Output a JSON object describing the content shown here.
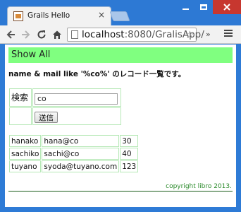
{
  "browser": {
    "tab_title": "Grails Hello",
    "tab_close": "×",
    "url_host": "localhost",
    "url_rest": ":8080/GralisApp/",
    "icons": {
      "back": "arrow-left-icon",
      "forward": "arrow-right-icon",
      "reload": "reload-icon",
      "home": "home-icon",
      "star": "star-icon",
      "extensions": "chevron-double-right-icon",
      "menu": "hamburger-menu-icon"
    }
  },
  "page": {
    "header_label": "Show All",
    "description": "name & mail like '%co%' のレコード一覧です。",
    "search_label": "検索",
    "search_value": "co",
    "submit_label": "送信",
    "results": [
      {
        "name": "hanako",
        "mail": "hana@co",
        "age": "30"
      },
      {
        "name": "sachiko",
        "mail": "sachi@co",
        "age": "40"
      },
      {
        "name": "tuyano",
        "mail": "syoda@tuyano.com",
        "age": "123"
      }
    ],
    "footer": "copyright libro 2013."
  },
  "colors": {
    "header_bg": "#80ff80",
    "frame": "#2e7bd6",
    "close_button": "#c7372f"
  }
}
